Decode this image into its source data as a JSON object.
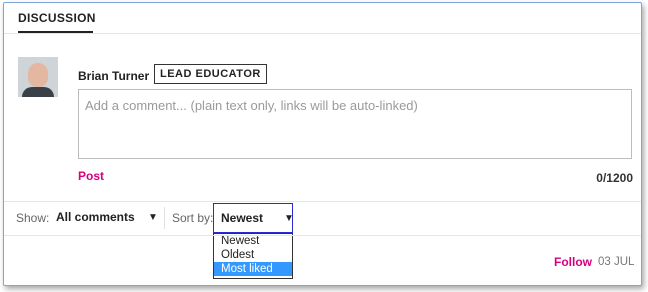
{
  "header": {
    "tab_label": "DISCUSSION"
  },
  "composer": {
    "author_name": "Brian Turner",
    "author_badge": "LEAD EDUCATOR",
    "placeholder": "Add a comment... (plain text only, links will be auto-linked)",
    "post_label": "Post",
    "char_counter": "0/1200"
  },
  "filters": {
    "show_label": "Show:",
    "show_value": "All comments",
    "sort_label": "Sort by:",
    "sort_value": "Newest",
    "sort_options": [
      "Newest",
      "Oldest",
      "Most liked"
    ],
    "highlighted_option": "Most liked"
  },
  "comment_meta": {
    "follow_label": "Follow",
    "date": "03 JUL"
  },
  "colors": {
    "accent": "#d6007f",
    "focus_border": "#2b2bd6",
    "highlight": "#3399ff"
  }
}
